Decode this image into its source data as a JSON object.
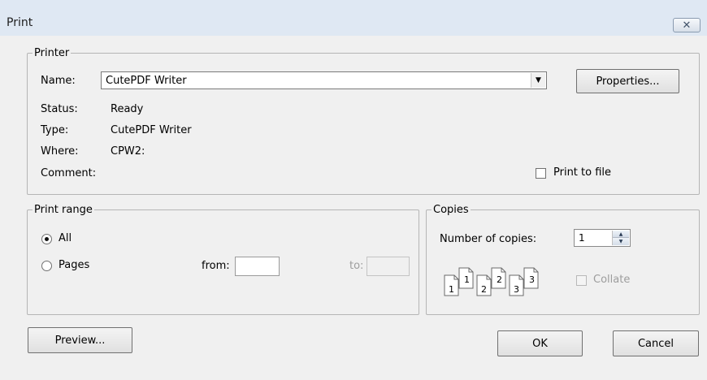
{
  "window": {
    "title": "Print",
    "close_symbol": "✕"
  },
  "printer": {
    "group_label": "Printer",
    "name_label": "Name:",
    "name_value": "CutePDF Writer",
    "properties_label": "Properties...",
    "status_label": "Status:",
    "status_value": "Ready",
    "type_label": "Type:",
    "type_value": "CutePDF Writer",
    "where_label": "Where:",
    "where_value": "CPW2:",
    "comment_label": "Comment:",
    "comment_value": "",
    "print_to_file_label": "Print to file",
    "print_to_file_checked": false
  },
  "print_range": {
    "group_label": "Print range",
    "all_label": "All",
    "all_selected": true,
    "pages_label": "Pages",
    "from_label": "from:",
    "from_value": "",
    "to_label": "to:",
    "to_value": ""
  },
  "copies": {
    "group_label": "Copies",
    "number_label": "Number of copies:",
    "number_value": "1",
    "collate_label": "Collate",
    "collate_checked": false,
    "collate_icon_pages": [
      {
        "front": "1",
        "back": "1"
      },
      {
        "front": "2",
        "back": "2"
      },
      {
        "front": "3",
        "back": "3"
      }
    ]
  },
  "buttons": {
    "preview": "Preview...",
    "ok": "OK",
    "cancel": "Cancel"
  }
}
